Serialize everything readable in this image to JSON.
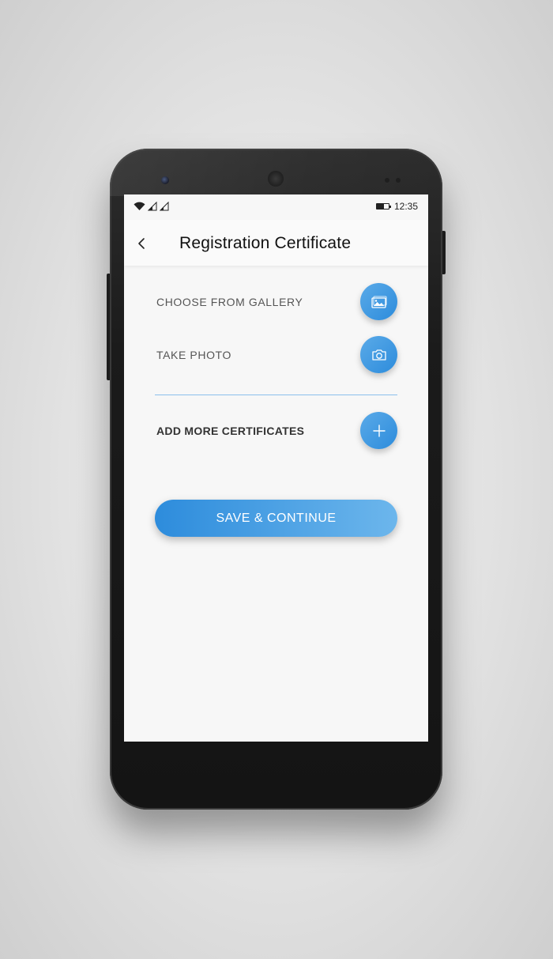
{
  "status_bar": {
    "time": "12:35"
  },
  "app_bar": {
    "title": "Registration Certificate"
  },
  "options": {
    "gallery_label": "CHOOSE FROM GALLERY",
    "photo_label": "TAKE PHOTO",
    "add_more_label": "ADD MORE CERTIFICATES"
  },
  "actions": {
    "save_label": "SAVE & CONTINUE"
  },
  "colors": {
    "accent": "#2d8cdc",
    "accent_light": "#6cb6ec"
  },
  "icons": [
    "back-arrow-icon",
    "gallery-icon",
    "camera-icon",
    "plus-icon",
    "wifi-icon",
    "signal-icon",
    "battery-icon"
  ]
}
